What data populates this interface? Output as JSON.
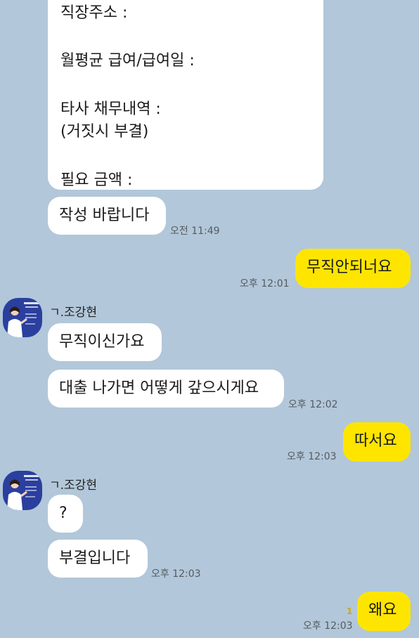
{
  "colors": {
    "background": "#b2c7d9",
    "incoming_bubble": "#ffffff",
    "outgoing_bubble": "#fee500",
    "timestamp": "#555b61",
    "unread": "#d4a800"
  },
  "form": {
    "line1": "직장주소 :",
    "line2": "월평균 급여/급여일 :",
    "line3": "타사 채무내역 :",
    "line4": "(거짓시 부결)",
    "line5": "필요 금액 :"
  },
  "messages": {
    "m1": {
      "text": "작성 바랍니다",
      "time": "오전 11:49"
    },
    "m2": {
      "text": "무직안되너요",
      "time": "오후 12:01"
    },
    "m3": {
      "sender": "ㄱ.조강현",
      "text": "무직이신가요"
    },
    "m4": {
      "text": "대출 나가면 어떻게 갚으시게요",
      "time": "오후 12:02"
    },
    "m5": {
      "text": "따서요",
      "time": "오후 12:03"
    },
    "m6": {
      "sender": "ㄱ.조강현",
      "text": "?"
    },
    "m7": {
      "text": "부결입니다",
      "time": "오후 12:03"
    },
    "m8": {
      "text": "왜요",
      "time": "오후 12:03",
      "unread": "1"
    }
  },
  "avatar": {
    "icon": "profile-photo"
  }
}
